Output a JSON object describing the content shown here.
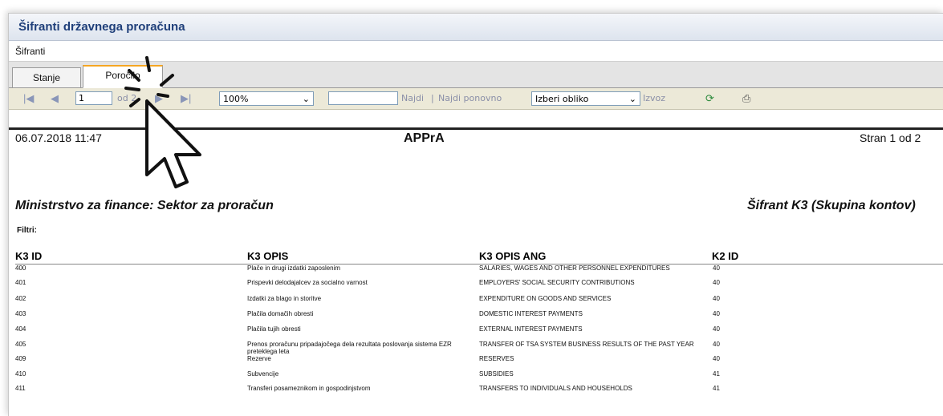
{
  "window": {
    "title": "Šifranti državnega proračuna"
  },
  "menu": {
    "items": [
      "Šifranti"
    ]
  },
  "tabs": [
    {
      "label": "Stanje"
    },
    {
      "label": "Poročilo"
    }
  ],
  "toolbar": {
    "page_value": "1",
    "of_label": "od 2",
    "zoom_value": "100%",
    "find_placeholder": "",
    "find_label": "Najdi",
    "separator": "|",
    "find_next_label": "Najdi ponovno",
    "format_value": "Izberi obliko",
    "export_label": "Izvoz",
    "icons": [
      "first-page-icon",
      "prev-page-icon",
      "next-page-icon",
      "last-page-icon",
      "refresh-icon",
      "print-icon"
    ]
  },
  "report": {
    "datetime": "06.07.2018 11:47",
    "app_name": "APPrA",
    "page_info": "Stran 1 od 2",
    "ministry": "Ministrstvo za finance: Sektor za proračun",
    "title": "Šifrant K3 (Skupina kontov)",
    "filters_label": "Filtri:",
    "columns": [
      "K3 ID",
      "K3 OPIS",
      "K3 OPIS ANG",
      "K2 ID"
    ],
    "rows": [
      {
        "id": "400",
        "opis": "Plače in drugi izdatki zaposlenim",
        "ang": "SALARIES, WAGES AND OTHER PERSONNEL EXPENDITURES",
        "k2": "40"
      },
      {
        "id": "401",
        "opis": "Prispevki delodajalcev za socialno varnost",
        "ang": "EMPLOYERS' SOCIAL SECURITY CONTRIBUTIONS",
        "k2": "40"
      },
      {
        "id": "402",
        "opis": "Izdatki za blago in storitve",
        "ang": "EXPENDITURE ON GOODS AND SERVICES",
        "k2": "40"
      },
      {
        "id": "403",
        "opis": "Plačila domačih obresti",
        "ang": "DOMESTIC INTEREST PAYMENTS",
        "k2": "40"
      },
      {
        "id": "404",
        "opis": "Plačila tujih obresti",
        "ang": "EXTERNAL INTEREST PAYMENTS",
        "k2": "40"
      },
      {
        "id": "405",
        "opis": "Prenos proračunu pripadajočega dela rezultata poslovanja sistema EZR preteklega leta",
        "ang": "TRANSFER OF TSA SYSTEM BUSINESS RESULTS OF THE PAST YEAR",
        "k2": "40"
      },
      {
        "id": "409",
        "opis": "Rezerve",
        "ang": "RESERVES",
        "k2": "40"
      },
      {
        "id": "410",
        "opis": "Subvencije",
        "ang": "SUBSIDIES",
        "k2": "41"
      },
      {
        "id": "411",
        "opis": "Transferi posameznikom in gospodinjstvom",
        "ang": "TRANSFERS TO INDIVIDUALS AND HOUSEHOLDS",
        "k2": "41"
      }
    ]
  },
  "colors": {
    "title_text": "#1f3f7a",
    "active_tab_accent": "#f5a623",
    "toolbar_bg": "#ece9d8"
  }
}
